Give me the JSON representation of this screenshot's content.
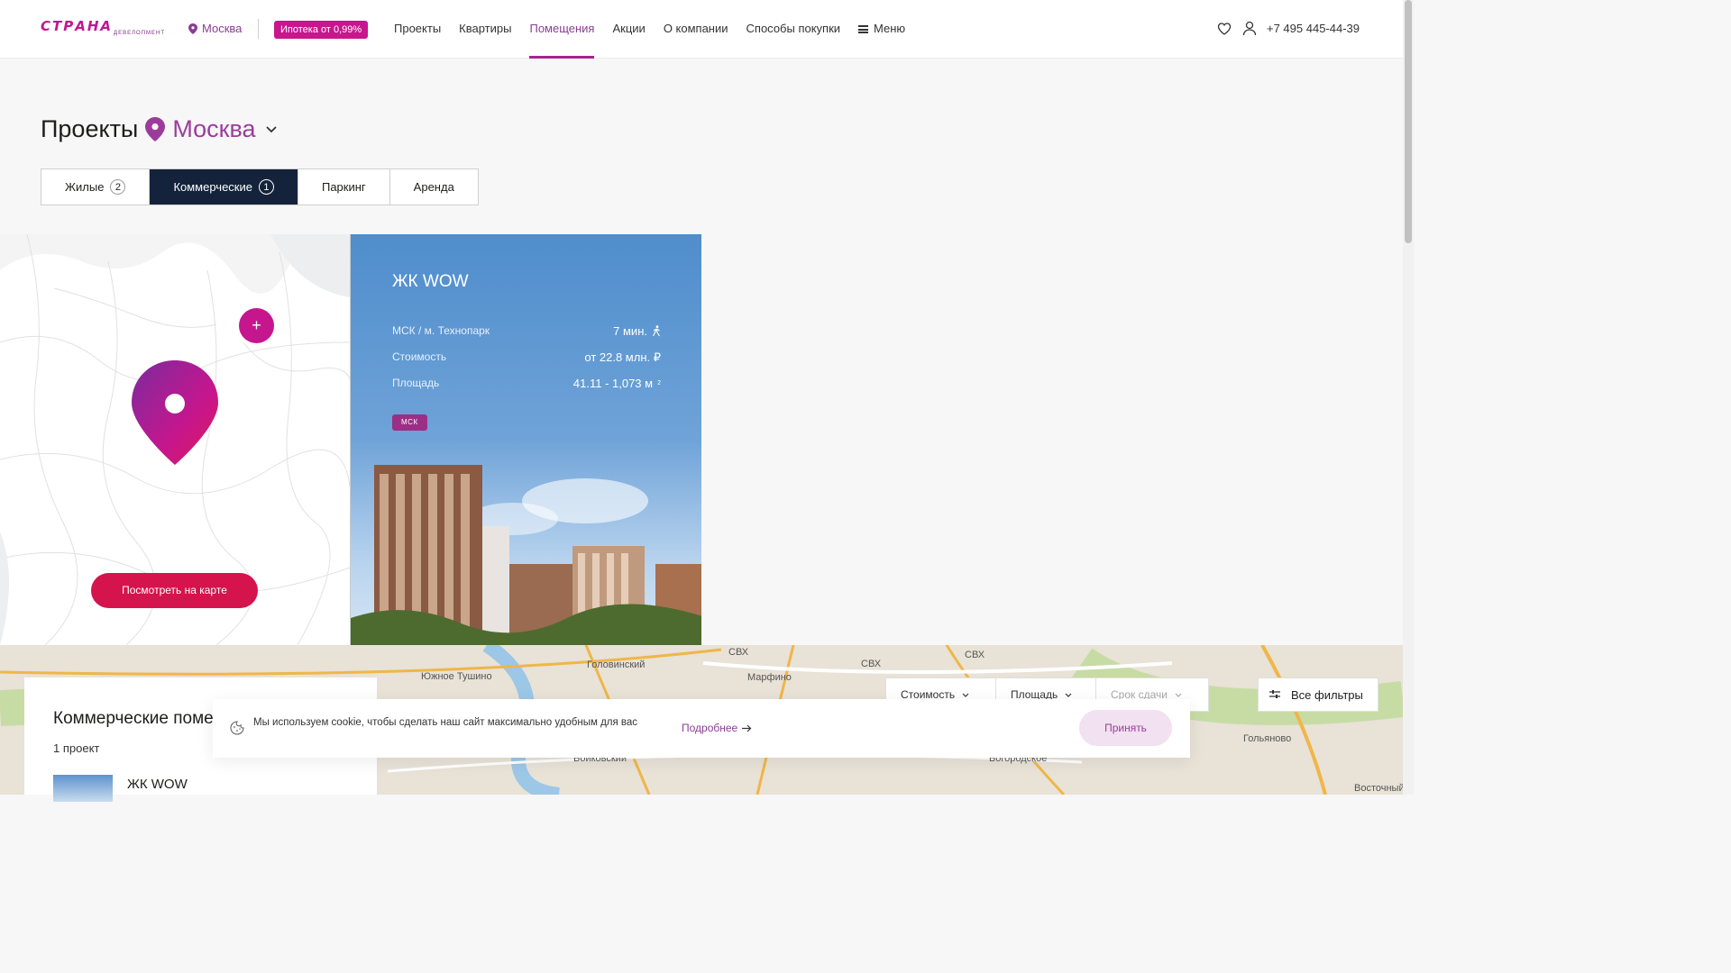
{
  "header": {
    "logo_text": "СТРАНА",
    "logo_sub": "ДЕВЕЛОПМЕНТ",
    "city": "Москва",
    "mortgage_label": "Ипотека от 0,99%",
    "nav": [
      {
        "label": "Проекты"
      },
      {
        "label": "Квартиры"
      },
      {
        "label": "Помещения",
        "active": true
      },
      {
        "label": "Акции"
      },
      {
        "label": "О компании"
      },
      {
        "label": "Способы покупки"
      },
      {
        "label": "Меню"
      }
    ],
    "phone": "+7 495 445-44-39",
    "icons": [
      "heart-icon",
      "user-icon",
      "menu-icon"
    ]
  },
  "page": {
    "title": "Проекты",
    "city": "Москва",
    "tabs": [
      {
        "label": "Жилые",
        "count": "2"
      },
      {
        "label": "Коммерческие",
        "count": "1",
        "active": true
      },
      {
        "label": "Паркинг",
        "count": ""
      },
      {
        "label": "Аренда",
        "count": ""
      }
    ]
  },
  "map_panel": {
    "plus_label": "+",
    "view_on_map": "Посмотреть на карте"
  },
  "project_card": {
    "title": "ЖК WOW",
    "rows": [
      {
        "label": "МСК / м. Технопарк",
        "value": "7 мин."
      },
      {
        "label": "Стоимость",
        "value": "от 22.8 млн. ₽"
      },
      {
        "label": "Площадь",
        "value": "41.11 - 1,073 м",
        "sup": "2"
      }
    ],
    "tag": "МСК"
  },
  "bottom": {
    "list_title": "Коммерческие помещения",
    "list_count": "1 проект",
    "list_item_name": "ЖК WOW",
    "filters": [
      {
        "label": "Стоимость"
      },
      {
        "label": "Площадь"
      },
      {
        "label": "Срок сдачи",
        "disabled": true
      }
    ],
    "all_filters": "Все фильтры",
    "map_labels": [
      "СВХ",
      "СВХ",
      "СВХ",
      "Южное Тушино",
      "Головинский",
      "Марфино",
      "Войковский",
      "Богородское",
      "Гольяново",
      "Восточный"
    ]
  },
  "cookie": {
    "text": "Мы используем cookie, чтобы сделать наш сайт максимально удобным для вас",
    "more": "Подробнее",
    "accept": "Принять"
  },
  "colors": {
    "brand_magenta": "#c5168e",
    "brand_purple": "#9b3c9c",
    "tab_active": "#14233b",
    "cta_red": "#d5134c"
  }
}
